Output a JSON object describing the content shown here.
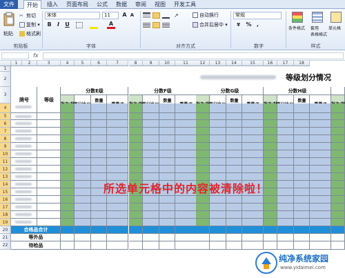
{
  "ribbon": {
    "tabs": [
      "文件",
      "开始",
      "插入",
      "页面布局",
      "公式",
      "数据",
      "审阅",
      "视图",
      "开发工具"
    ],
    "active_tab": "开始",
    "clipboard": {
      "paste": "粘贴",
      "cut": "剪切",
      "copy": "复制 ▾",
      "format_painter": "格式刷",
      "label": "剪贴板"
    },
    "font": {
      "name": "宋体",
      "size": "11",
      "label": "字体",
      "grow": "A",
      "shrink": "A",
      "bold": "B",
      "italic": "I",
      "underline": "U"
    },
    "alignment": {
      "wrap": "自动换行",
      "merge": "合并后居中 ▾",
      "label": "对齐方式"
    },
    "number": {
      "format": "常规",
      "label": "数字",
      "percent": "%",
      "comma": ","
    },
    "styles": {
      "conditional": "条件格式",
      "table": "套用\n表格格式",
      "cell_styles": "单元格",
      "label": "样式"
    }
  },
  "formula_bar": {
    "fx": "fx",
    "name_box": ""
  },
  "sheet": {
    "col_headers": [
      "1",
      "2",
      "3",
      "4",
      "5",
      "6",
      "7",
      "8",
      "9",
      "10",
      "11",
      "12",
      "13",
      "14",
      "15",
      "16",
      "17",
      "18"
    ],
    "title": "等级划分情况",
    "header_row": {
      "seq": "牌号",
      "grade": "等级"
    },
    "groups": [
      "分数E级",
      "分数F级",
      "分数G级",
      "分数H级"
    ],
    "subheaders": [
      "批次/批",
      "百分比/%",
      "数量\n箱/箱",
      "重量/T"
    ],
    "row_numbers": [
      "1",
      "2",
      "3",
      "4",
      "5",
      "6",
      "7",
      "8",
      "9",
      "10",
      "11",
      "12",
      "13",
      "14",
      "15",
      "16",
      "17",
      "18",
      "19",
      "20",
      "21",
      "22"
    ],
    "footer_rows": [
      "合格品合计",
      "等外品",
      "待检品"
    ],
    "overlay_text": "所选单元格中的内容被清除啦！"
  },
  "watermark": {
    "title": "纯净系统家园",
    "url": "www.yidaimei.com"
  },
  "colors": {
    "green": "#7fb870",
    "blue": "#b8cbe6",
    "dark_blue": "#1e8fd8",
    "overlay": "#e0262d"
  }
}
